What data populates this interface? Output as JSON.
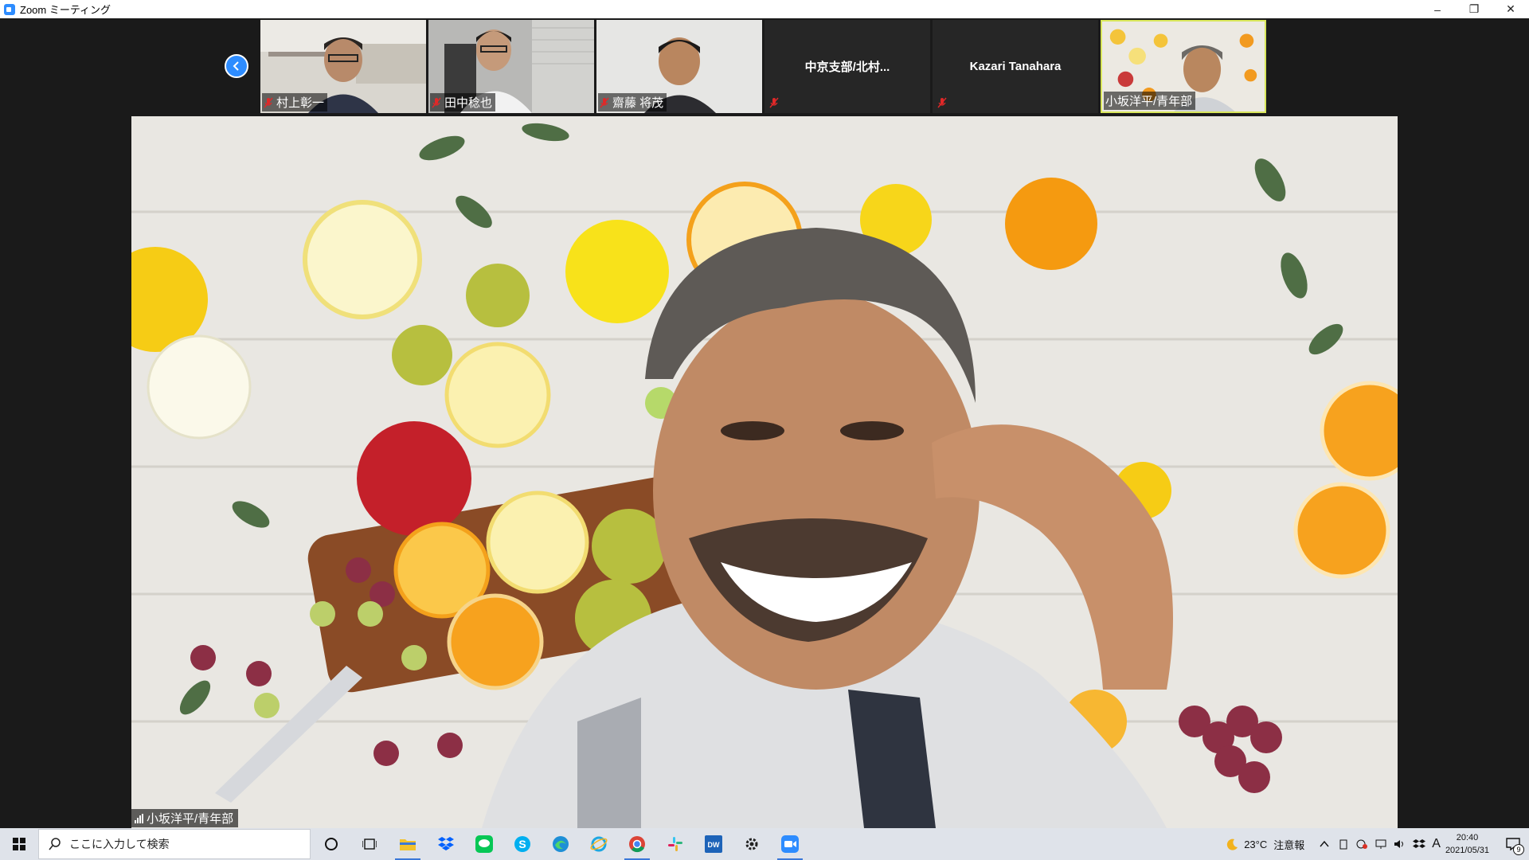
{
  "window": {
    "title": "Zoom ミーティング",
    "minimize": "–",
    "restore": "❐",
    "close": "✕"
  },
  "participants": [
    {
      "name": "村上彰一",
      "has_video": true,
      "muted": true
    },
    {
      "name": "田中稔也",
      "has_video": true,
      "muted": true
    },
    {
      "name": "齋藤 将茂",
      "has_video": true,
      "muted": true
    },
    {
      "name": "中京支部/北村...",
      "has_video": false,
      "muted": true
    },
    {
      "name": "Kazari Tanahara",
      "has_video": false,
      "muted": true
    },
    {
      "name": "小坂洋平/青年部",
      "has_video": true,
      "muted": false,
      "active": true
    }
  ],
  "main_speaker": {
    "name": "小坂洋平/青年部"
  },
  "taskbar": {
    "search_placeholder": "ここに入力して検索",
    "weather_temp": "23°C",
    "weather_alert": "注意報",
    "ime": "A",
    "time": "20:40",
    "date": "2021/05/31",
    "notification_count": "9"
  },
  "colors": {
    "accent": "#2d8cff",
    "active_border": "#d8e65a",
    "mic_muted": "#e02828"
  }
}
